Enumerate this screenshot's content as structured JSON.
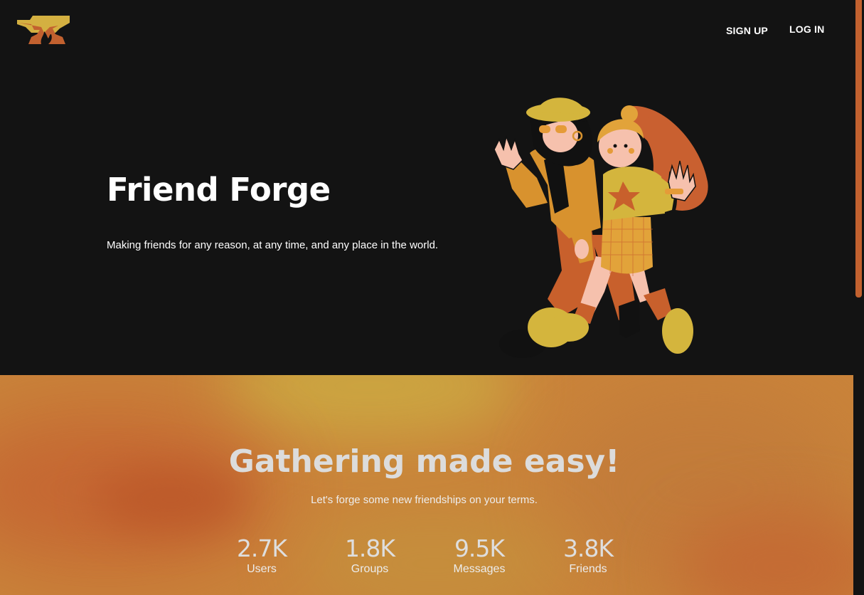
{
  "nav": {
    "signup_label": "SIGN UP",
    "login_label": "LOG IN"
  },
  "hero": {
    "title": "Friend Forge",
    "tagline": "Making friends for any reason, at any time, and any place in the world."
  },
  "gathering": {
    "title": "Gathering made easy!",
    "subtitle": "Let's forge some new friendships on your terms.",
    "stats": [
      {
        "value": "2.7K",
        "label": "Users"
      },
      {
        "value": "1.8K",
        "label": "Groups"
      },
      {
        "value": "9.5K",
        "label": "Messages"
      },
      {
        "value": "3.8K",
        "label": "Friends"
      }
    ]
  },
  "colors": {
    "background": "#131313",
    "accent_orange": "#c2612f",
    "accent_yellow": "#d4b041",
    "section_gradient": "#c9833a"
  },
  "icons": {
    "logo": "anvil-flame-icon"
  }
}
